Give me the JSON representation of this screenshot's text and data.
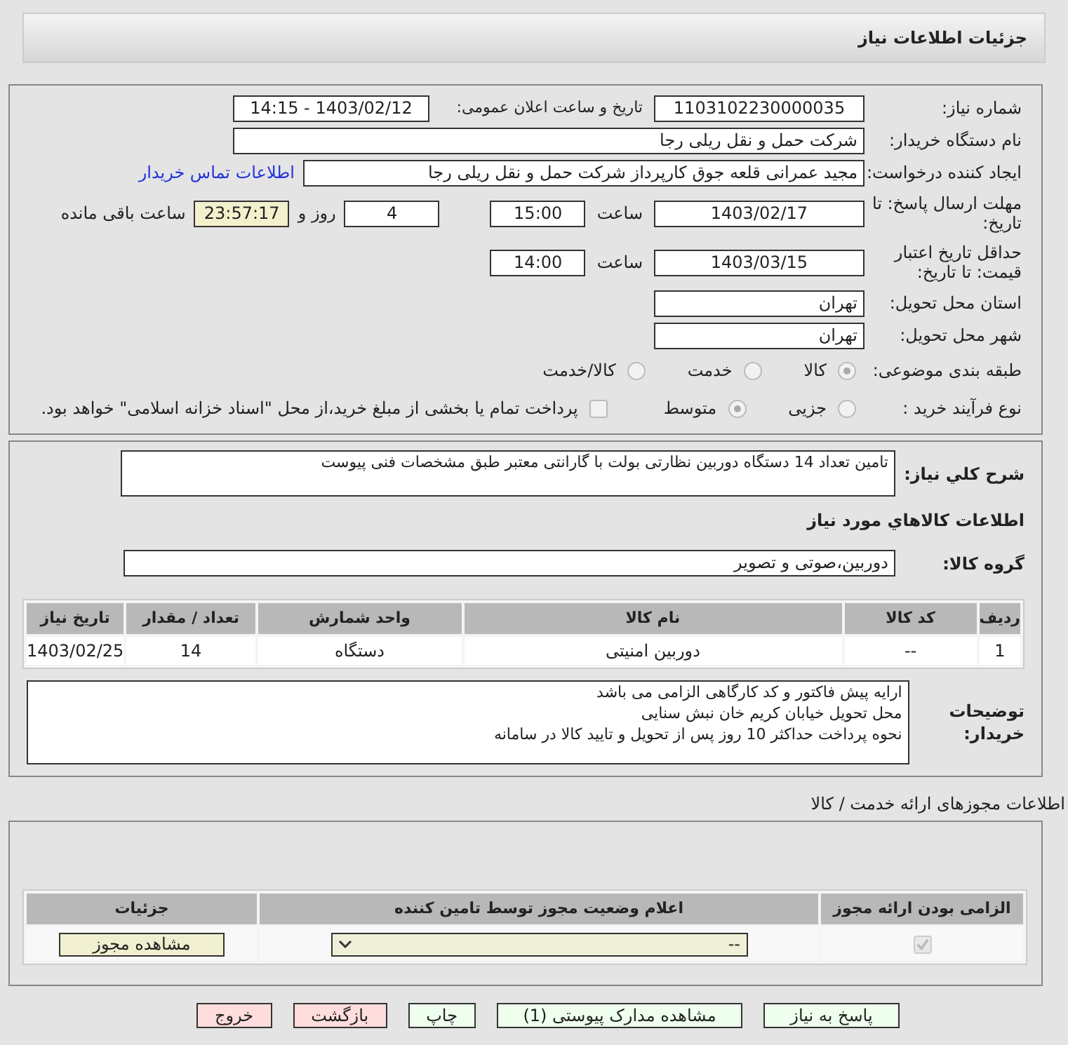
{
  "header": {
    "title": "جزئیات اطلاعات نیاز"
  },
  "info": {
    "need_number_label": "شماره نیاز:",
    "need_number": "1103102230000035",
    "announce_label": "تاریخ و ساعت اعلان عمومی:",
    "announce_value": "1403/02/12 - 14:15",
    "buyer_label": "نام دستگاه خریدار:",
    "buyer": "شرکت حمل و نقل ریلی رجا",
    "requester_label": "ایجاد کننده درخواست:",
    "requester": "مجید عمرانی قلعه جوق کارپرداز شرکت حمل و نقل ریلی رجا",
    "contact_link": "اطلاعات تماس خریدار",
    "deadline_label": "مهلت ارسال پاسخ: تا تاریخ:",
    "deadline_date": "1403/02/17",
    "time_label_1": "ساعت",
    "deadline_time": "15:00",
    "days": "4",
    "days_label": "روز و",
    "remaining": "23:57:17",
    "remaining_label": "ساعت باقی مانده",
    "validity_label": "حداقل تاریخ اعتبار قیمت: تا تاریخ:",
    "validity_date": "1403/03/15",
    "time_label_2": "ساعت",
    "validity_time": "14:00",
    "province_label": "استان محل تحویل:",
    "province": "تهران",
    "city_label": "شهر محل تحویل:",
    "city": "تهران",
    "category_label": "طبقه بندی موضوعی:",
    "category_options": [
      {
        "label": "کالا",
        "selected": true
      },
      {
        "label": "خدمت",
        "selected": false
      },
      {
        "label": "کالا/خدمت",
        "selected": false
      }
    ],
    "process_label": "نوع فرآیند خرید :",
    "process_options": [
      {
        "label": "جزیی",
        "selected": false
      },
      {
        "label": "متوسط",
        "selected": true
      }
    ],
    "treasury": {
      "label": "پرداخت تمام یا بخشی از مبلغ خرید،از محل \"اسناد خزانه اسلامی\" خواهد بود.",
      "checked": false
    }
  },
  "details": {
    "description_label": "شرح کلي نیاز:",
    "description": "تامین تعداد 14 دستگاه دوربین نظارتی بولت با گارانتی معتبر طبق مشخصات فنی پیوست",
    "goods_title": "اطلاعات کالاهاي مورد نیاز",
    "group_label": "گروه کالا:",
    "group": "دوربین،صوتی و تصویر",
    "table": {
      "columns": [
        "ردیف",
        "کد کالا",
        "نام کالا",
        "واحد شمارش",
        "تعداد / مقدار",
        "تاریخ نیاز"
      ],
      "rows": [
        [
          "1",
          "--",
          "دوربین امنیتی",
          "دستگاه",
          "14",
          "1403/02/25"
        ]
      ]
    },
    "notes_label": "توضیحات خریدار:",
    "notes": [
      "ارایه پیش فاکتور و کد کارگاهی الزامی می باشد",
      "محل تحویل خیابان کریم خان نبش سنایی",
      "نحوه پرداخت حداکثر 10 روز پس از تحویل و تایید کالا در سامانه"
    ]
  },
  "permits": {
    "title": "اطلاعات مجوزهای ارائه خدمت / کالا",
    "columns": [
      "الزامی بودن ارائه مجوز",
      "اعلام وضعیت مجوز توسط تامین کننده",
      "جزئیات"
    ],
    "rows": [
      {
        "required": true,
        "status": "--",
        "details_button": "مشاهده مجوز"
      }
    ]
  },
  "buttons": [
    {
      "label": "پاسخ به نیاز",
      "kind": "action"
    },
    {
      "label": "مشاهده مدارک پیوستی (1)",
      "kind": "action"
    },
    {
      "label": "چاپ",
      "kind": "action"
    },
    {
      "label": "بازگشت",
      "kind": "nav"
    },
    {
      "label": "خروج",
      "kind": "nav"
    }
  ]
}
